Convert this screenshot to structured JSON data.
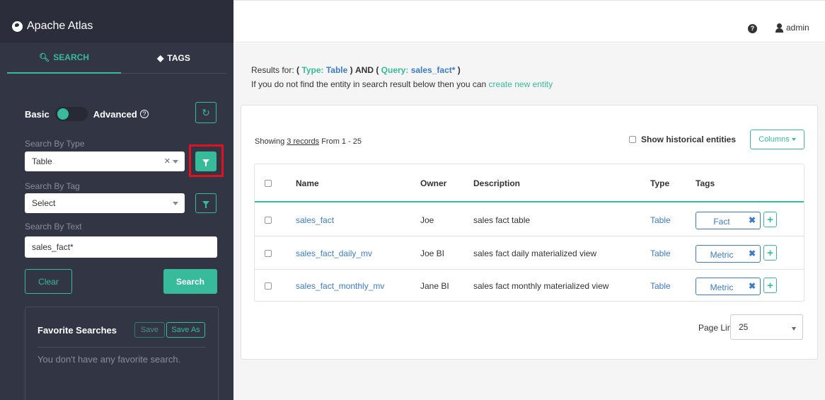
{
  "app": {
    "title": "Apache Atlas"
  },
  "tabs": {
    "search": "SEARCH",
    "tags": "TAGS"
  },
  "search_mode": {
    "basic": "Basic",
    "advanced": "Advanced"
  },
  "filters": {
    "type_label": "Search By Type",
    "type_value": "Table",
    "tag_label": "Search By Tag",
    "tag_value": "Select",
    "text_label": "Search By Text",
    "text_value": "sales_fact*",
    "clear_label": "Clear",
    "search_label": "Search"
  },
  "favorites": {
    "title": "Favorite Searches",
    "save": "Save",
    "save_as": "Save As",
    "empty": "You don't have any favorite search."
  },
  "header": {
    "user": "admin"
  },
  "results": {
    "prefix": "Results for:",
    "type_open": "(",
    "type_label": "Type:",
    "type_value": "Table",
    "type_close": ")",
    "and": "AND",
    "query_open": "(",
    "query_label": "Query:",
    "query_value": "sales_fact*",
    "query_close": ")",
    "hint": "If you do not find the entity in search result below then you can",
    "hint_link": "create new entity",
    "showing_prefix": "Showing",
    "showing_count": "3 records",
    "showing_suffix": "From 1 - 25",
    "historical": "Show historical entities",
    "columns": "Columns"
  },
  "table": {
    "headers": {
      "name": "Name",
      "owner": "Owner",
      "description": "Description",
      "type": "Type",
      "tags": "Tags"
    },
    "rows": [
      {
        "name": "sales_fact",
        "owner": "Joe",
        "description": "sales fact table",
        "type": "Table",
        "tag": "Fact"
      },
      {
        "name": "sales_fact_daily_mv",
        "owner": "Joe BI",
        "description": "sales fact daily materialized view",
        "type": "Table",
        "tag": "Metric"
      },
      {
        "name": "sales_fact_monthly_mv",
        "owner": "Jane BI",
        "description": "sales fact monthly materialized view",
        "type": "Table",
        "tag": "Metric"
      }
    ]
  },
  "pagination": {
    "label": "Page Limit :",
    "value": "25"
  },
  "colors": {
    "accent": "#37bb9b",
    "link": "#3c7bc7",
    "sidebar": "#323544",
    "highlight": "#e3101f"
  }
}
